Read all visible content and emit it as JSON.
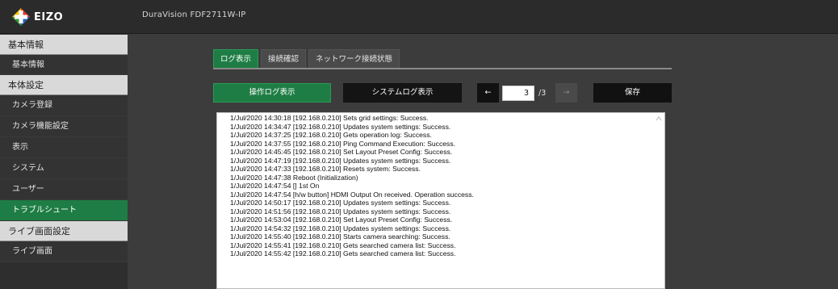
{
  "header": {
    "logo_text": "EIZO",
    "model_name": "DuraVision FDF2711W-IP"
  },
  "sidebar": {
    "sections": [
      {
        "label": "基本情報",
        "items": [
          {
            "label": "基本情報"
          }
        ]
      },
      {
        "label": "本体設定",
        "items": [
          {
            "label": "カメラ登録"
          },
          {
            "label": "カメラ機能設定"
          },
          {
            "label": "表示"
          },
          {
            "label": "システム"
          },
          {
            "label": "ユーザー"
          },
          {
            "label": "トラブルシュート",
            "active": true
          }
        ]
      },
      {
        "label": "ライブ画面設定",
        "items": [
          {
            "label": "ライブ画面"
          }
        ]
      }
    ]
  },
  "tabs": [
    {
      "label": "ログ表示",
      "active": true
    },
    {
      "label": "接続確認"
    },
    {
      "label": "ネットワーク接続状態"
    }
  ],
  "toolbar": {
    "operation_log_label": "操作ログ表示",
    "system_log_label": "システムログ表示",
    "prev_label": "←",
    "next_label": "→",
    "page_current": "3",
    "page_total": "/3",
    "save_label": "保存"
  },
  "log_lines": [
    "1/Jul/2020 14:30:18  [192.168.0.210] Sets grid settings: Success.",
    "1/Jul/2020 14:34:47  [192.168.0.210] Updates system settings: Success.",
    "1/Jul/2020 14:37:25  [192.168.0.210] Gets operation log: Success.",
    "1/Jul/2020 14:37:55  [192.168.0.210] Ping Command Execution: Success.",
    "1/Jul/2020 14:45:45  [192.168.0.210] Set Layout Preset Config: Success.",
    "1/Jul/2020 14:47:19  [192.168.0.210] Updates system settings: Success.",
    "1/Jul/2020 14:47:33  [192.168.0.210] Resets system: Success.",
    "1/Jul/2020 14:47:38  Reboot (Initialization)",
    "1/Jul/2020 14:47:54  [] 1st On",
    "1/Jul/2020 14:47:54  [h/w button] HDMI Output On received. Operation success.",
    "1/Jul/2020 14:50:17  [192.168.0.210] Updates system settings: Success.",
    "1/Jul/2020 14:51:56  [192.168.0.210] Updates system settings: Success.",
    "1/Jul/2020 14:53:04  [192.168.0.210] Set Layout Preset Config: Success.",
    "1/Jul/2020 14:54:32  [192.168.0.210] Updates system settings: Success.",
    "1/Jul/2020 14:55:40  [192.168.0.210] Starts camera searching: Success.",
    "1/Jul/2020 14:55:41  [192.168.0.210] Gets searched camera list: Success.",
    "1/Jul/2020 14:55:42  [192.168.0.210] Gets searched camera list: Success."
  ],
  "icons": {
    "logo": "eizo-logo-icon",
    "scroll_up": "chevron-up-icon"
  },
  "colors": {
    "accent_green": "#1e7d44",
    "topbar": "#2b2b2b",
    "background": "#3c3c3c"
  }
}
